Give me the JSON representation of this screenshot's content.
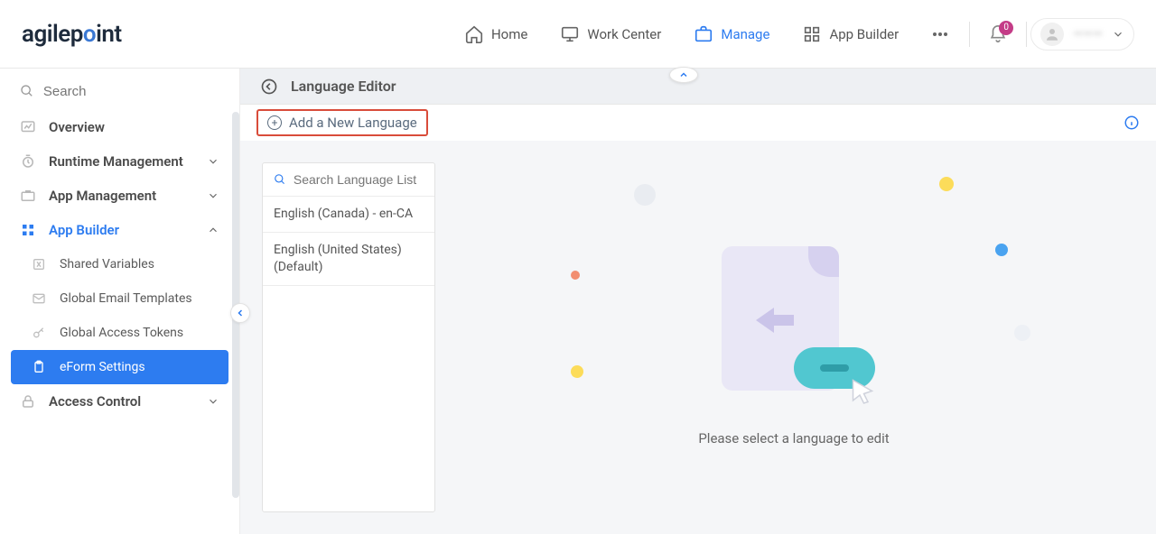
{
  "header": {
    "logo_text": "agilepoint",
    "nav": [
      {
        "label": "Home"
      },
      {
        "label": "Work Center"
      },
      {
        "label": "Manage"
      },
      {
        "label": "App Builder"
      }
    ],
    "notifications": "0",
    "user_name": "———"
  },
  "sidebar": {
    "search_placeholder": "Search",
    "items": [
      {
        "label": "Overview"
      },
      {
        "label": "Runtime Management"
      },
      {
        "label": "App Management"
      },
      {
        "label": "App Builder"
      },
      {
        "label": "Access Control"
      }
    ],
    "sub": [
      {
        "label": "Shared Variables"
      },
      {
        "label": "Global Email Templates"
      },
      {
        "label": "Global Access Tokens"
      },
      {
        "label": "eForm Settings"
      }
    ]
  },
  "page": {
    "title": "Language Editor",
    "add_btn": "Add a New Language",
    "lang_search_placeholder": "Search Language List",
    "languages": [
      "English (Canada) - en-CA",
      "English (United States) (Default)"
    ],
    "empty_text": "Please select a language to edit"
  }
}
